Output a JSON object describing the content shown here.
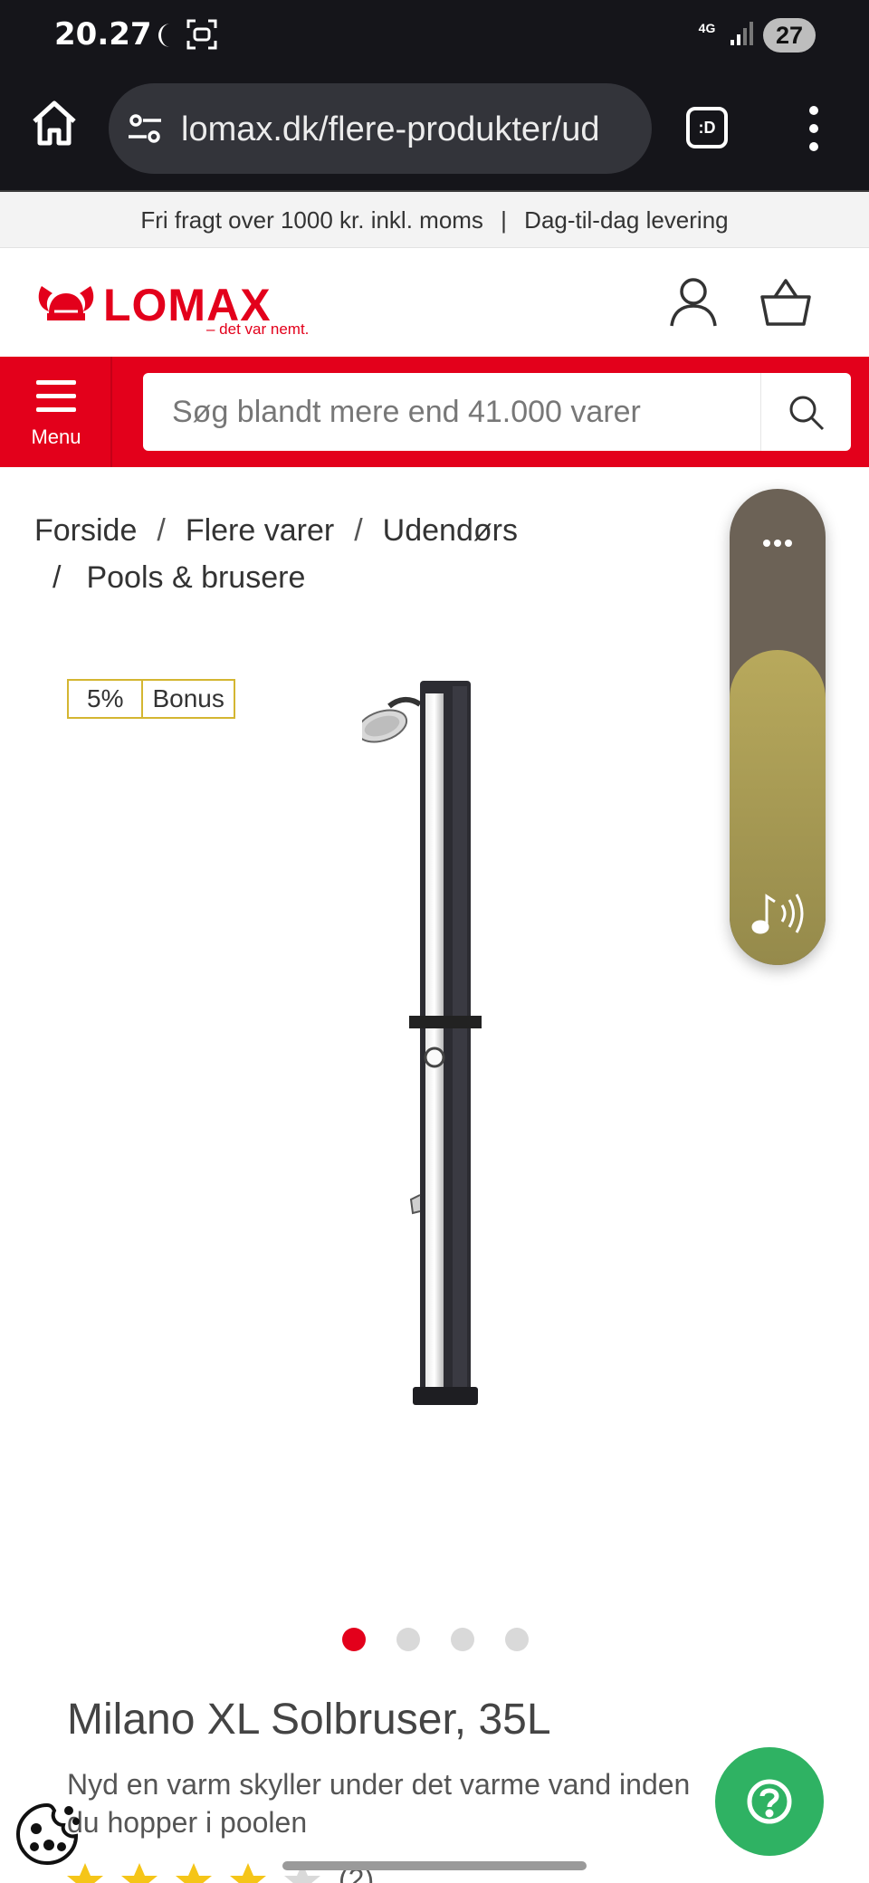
{
  "status_bar": {
    "time": "20.27",
    "network": "4G",
    "battery": "27"
  },
  "browser": {
    "url": "lomax.dk/flere-produkter/ud",
    "tabs_label": ":D"
  },
  "promo": {
    "shipping": "Fri fragt over 1000 kr. inkl. moms",
    "separator": "|",
    "delivery": "Dag-til-dag levering"
  },
  "header": {
    "logo_text": "LOMAX",
    "logo_tagline": "– det var nemt."
  },
  "nav": {
    "menu_label": "Menu",
    "search_placeholder": "Søg blandt mere end 41.000 varer"
  },
  "breadcrumb": {
    "items": [
      "Forside",
      "Flere varer",
      "Udendørs",
      "Pools & brusere"
    ],
    "separator": "/"
  },
  "product": {
    "bonus_percent": "5%",
    "bonus_label": "Bonus",
    "title": "Milano XL Solbruser, 35L",
    "description": "Nyd en varm skyller under det varme vand inden du hopper i poolen",
    "rating_count": "(2)",
    "rating_stars": 4,
    "image_count": 4,
    "active_image": 1
  },
  "colors": {
    "brand_red": "#e3001b",
    "help_green": "#2fb263",
    "bonus_gold": "#d4b631",
    "star_yellow": "#f5c518"
  }
}
